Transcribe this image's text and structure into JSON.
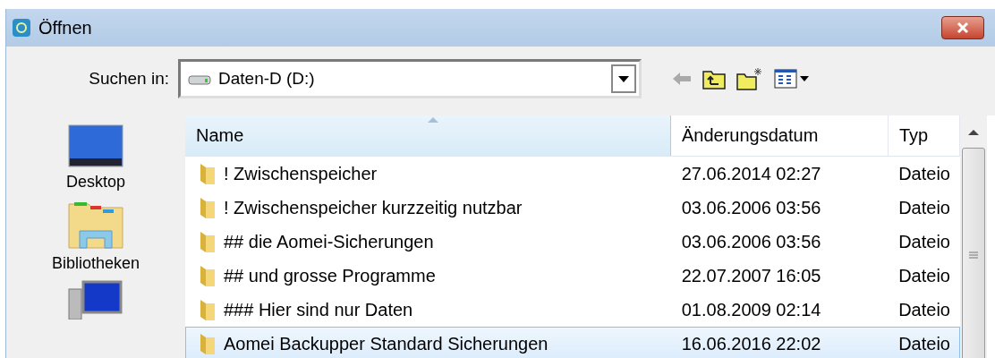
{
  "window": {
    "title": "Öffnen"
  },
  "look_in": {
    "label": "Suchen in:",
    "value": "Daten-D (D:)"
  },
  "places": [
    {
      "label": "Desktop",
      "kind": "desktop"
    },
    {
      "label": "Bibliotheken",
      "kind": "libraries"
    },
    {
      "kind": "computer"
    }
  ],
  "table": {
    "columns": [
      {
        "label": "Name",
        "sorted": true
      },
      {
        "label": "Änderungsdatum",
        "sorted": false
      },
      {
        "label": "Typ",
        "sorted": false
      }
    ],
    "rows": [
      {
        "name": "! Zwischenspeicher",
        "date": "27.06.2014 02:27",
        "type": "Dateio",
        "selected": false
      },
      {
        "name": "! Zwischenspeicher kurzzeitig nutzbar",
        "date": "03.06.2006 03:56",
        "type": "Dateio",
        "selected": false
      },
      {
        "name": "## die Aomei-Sicherungen",
        "date": "03.06.2006 03:56",
        "type": "Dateio",
        "selected": false
      },
      {
        "name": "## und grosse Programme",
        "date": "22.07.2007 16:05",
        "type": "Dateio",
        "selected": false
      },
      {
        "name": "### Hier sind nur Daten",
        "date": "01.08.2009 02:14",
        "type": "Dateio",
        "selected": false
      },
      {
        "name": "Aomei Backupper Standard Sicherungen",
        "date": "16.06.2016 22:02",
        "type": "Dateio",
        "selected": true
      }
    ]
  }
}
